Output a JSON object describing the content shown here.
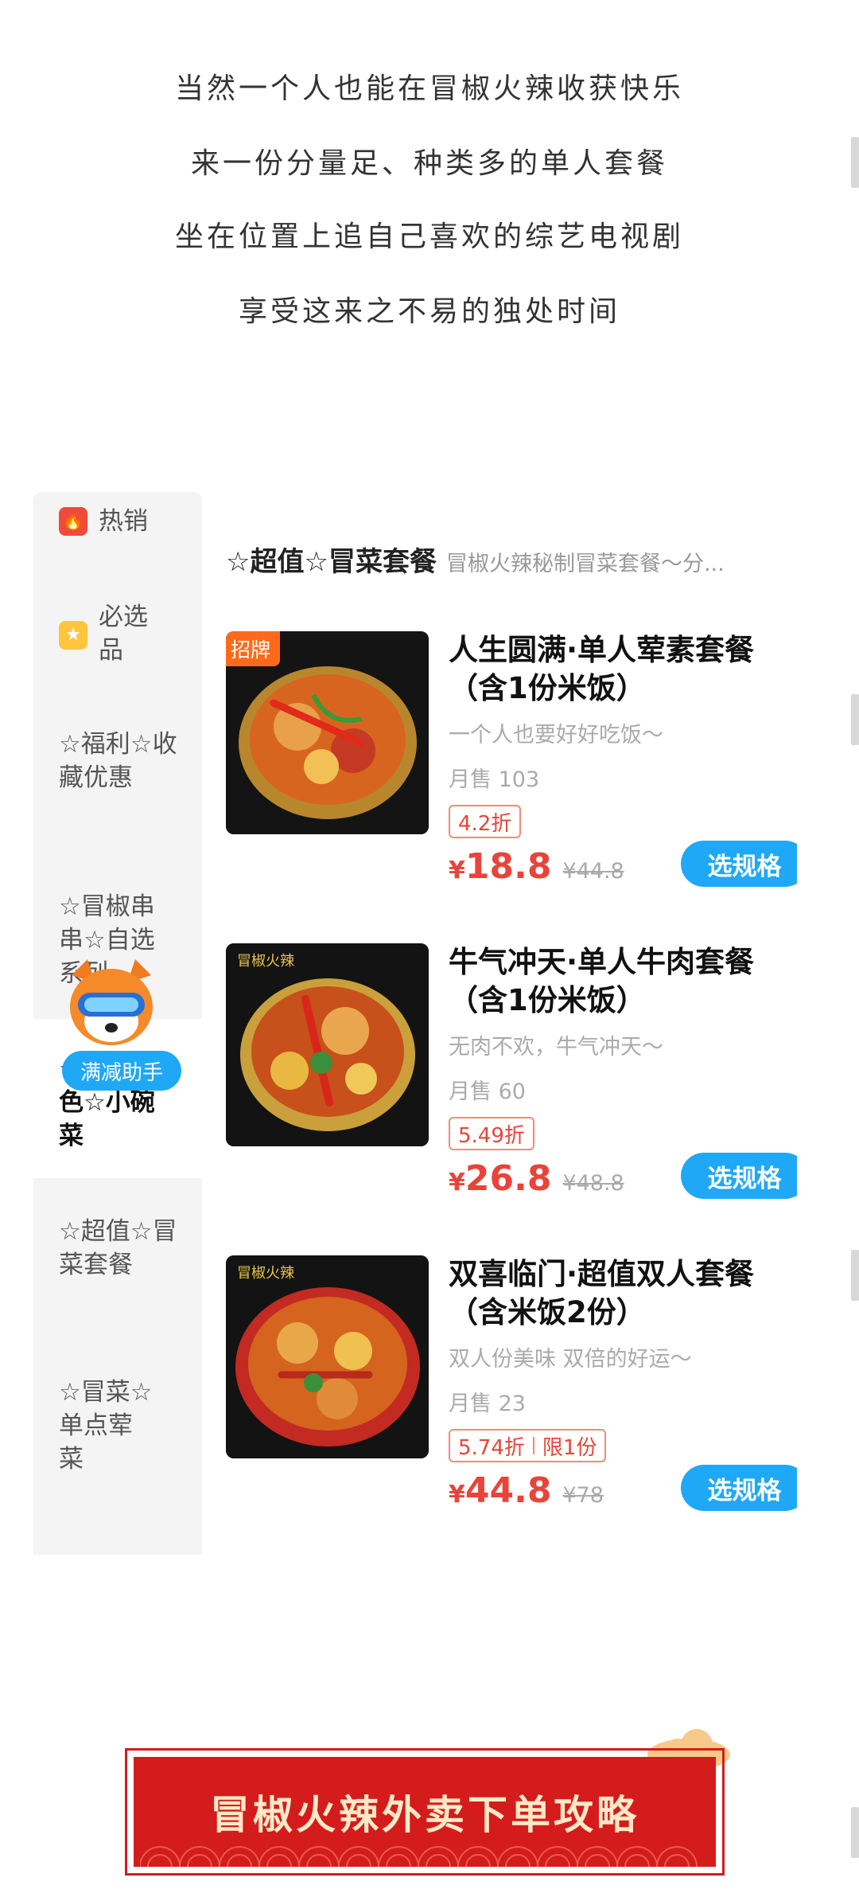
{
  "intro_lines": [
    "当然一个人也能在冒椒火辣收获快乐",
    "来一份分量足、种类多的单人套餐",
    "坐在位置上追自己喜欢的综艺电视剧",
    "享受这来之不易的独处时间"
  ],
  "sidebar": {
    "items": [
      {
        "label": "热销",
        "icon": "fire-icon"
      },
      {
        "label": "必选品",
        "icon": "star-icon"
      },
      {
        "label": "☆福利☆收藏优惠"
      },
      {
        "label": "☆冒椒串串☆自选系列"
      },
      {
        "label": "☆冒椒特色☆小碗菜",
        "active": true
      },
      {
        "label": "☆超值☆冒菜套餐"
      },
      {
        "label": "☆冒菜☆单点荤菜"
      }
    ]
  },
  "section": {
    "title": "☆超值☆冒菜套餐",
    "desc": "冒椒火辣秘制冒菜套餐～分..."
  },
  "products": [
    {
      "badge": "招牌",
      "name": "人生圆满·单人荤素套餐 （含1份米饭）",
      "desc": "一个人也要好好吃饭～",
      "sales": "月售 103",
      "discount": [
        "4.2折"
      ],
      "currency": "¥",
      "price": "18.8",
      "old_price": "¥44.8",
      "button": "选规格"
    },
    {
      "name": "牛气冲天·单人牛肉套餐（含1份米饭）",
      "desc": "无肉不欢，牛气冲天～",
      "sales": "月售 60",
      "discount": [
        "5.49折"
      ],
      "currency": "¥",
      "price": "26.8",
      "old_price": "¥48.8",
      "button": "选规格"
    },
    {
      "name": "双喜临门·超值双人套餐（含米饭2份）",
      "desc": "双人份美味 双倍的好运～",
      "sales": "月售 23",
      "discount": [
        "5.74折",
        "限1份"
      ],
      "currency": "¥",
      "price": "44.8",
      "old_price": "¥78",
      "button": "选规格"
    }
  ],
  "promo_pill": "满减助手",
  "banner": {
    "text": "冒椒火辣外卖下单攻略"
  },
  "colors": {
    "accent": "#1fa8f5",
    "price": "#e8443a",
    "banner": "#d41c1c"
  }
}
